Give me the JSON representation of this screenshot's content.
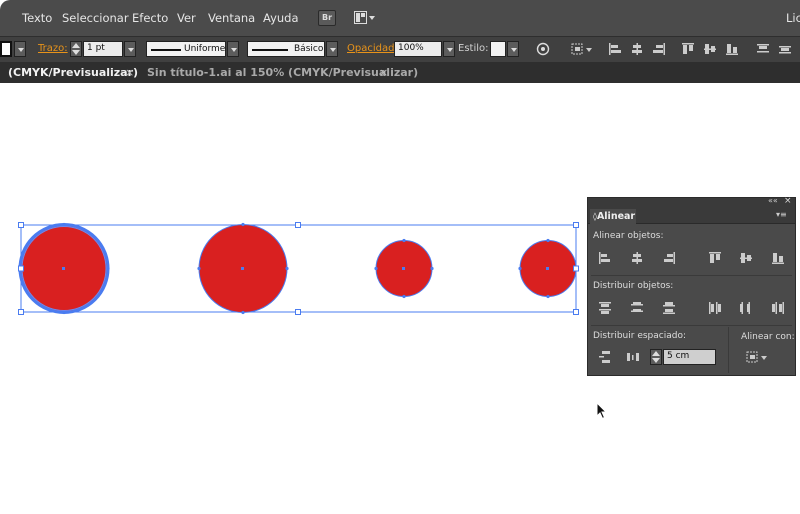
{
  "menubar": {
    "items": [
      "Texto",
      "Seleccionar",
      "Efecto",
      "Ver",
      "Ventana",
      "Ayuda"
    ],
    "bridge_label": "Br",
    "right_label": "Lic"
  },
  "controlbar": {
    "stroke_label": "Trazo:",
    "stroke_value": "1 pt",
    "profile_value": "Uniforme",
    "brush_value": "Básico",
    "opacity_label": "Opacidad:",
    "opacity_value": "100%",
    "style_label": "Estilo:"
  },
  "tabs": [
    {
      "label": "(CMYK/Previsualizar)",
      "active": true
    },
    {
      "label": "Sin título-1.ai al 150% (CMYK/Previsualizar)",
      "active": false
    }
  ],
  "tab_close_glyph": "×",
  "canvas": {
    "fill_color": "#d92020",
    "selection_color": "#4a7cf0"
  },
  "align_panel": {
    "collapse_glyph": "««",
    "close_glyph": "×",
    "tab_label": "Alinear",
    "menu_glyph": "▾≡",
    "align_objects_label": "Alinear objetos:",
    "distribute_objects_label": "Distribuir objetos:",
    "distribute_spacing_label": "Distribuir espaciado:",
    "align_to_label": "Alinear con:",
    "spacing_value": "5 cm"
  },
  "colors": {
    "menubar_bg": "#4b4b4b",
    "controlbar_bg": "#404040",
    "tabbar_bg": "#2e2e2e",
    "panel_bg": "#4a4a4a",
    "accent_label": "#e8931a"
  }
}
